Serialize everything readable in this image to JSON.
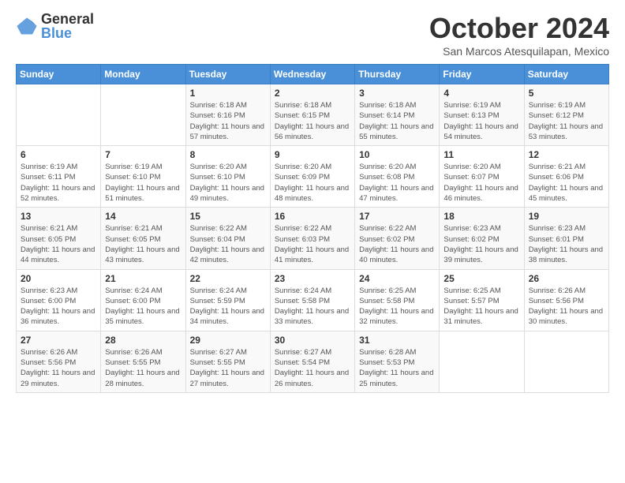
{
  "logo": {
    "general": "General",
    "blue": "Blue"
  },
  "title": {
    "month": "October 2024",
    "location": "San Marcos Atesquilapan, Mexico"
  },
  "days_of_week": [
    "Sunday",
    "Monday",
    "Tuesday",
    "Wednesday",
    "Thursday",
    "Friday",
    "Saturday"
  ],
  "weeks": [
    [
      {
        "day": "",
        "sunrise": "",
        "sunset": "",
        "daylight": ""
      },
      {
        "day": "",
        "sunrise": "",
        "sunset": "",
        "daylight": ""
      },
      {
        "day": "1",
        "sunrise": "Sunrise: 6:18 AM",
        "sunset": "Sunset: 6:16 PM",
        "daylight": "Daylight: 11 hours and 57 minutes."
      },
      {
        "day": "2",
        "sunrise": "Sunrise: 6:18 AM",
        "sunset": "Sunset: 6:15 PM",
        "daylight": "Daylight: 11 hours and 56 minutes."
      },
      {
        "day": "3",
        "sunrise": "Sunrise: 6:18 AM",
        "sunset": "Sunset: 6:14 PM",
        "daylight": "Daylight: 11 hours and 55 minutes."
      },
      {
        "day": "4",
        "sunrise": "Sunrise: 6:19 AM",
        "sunset": "Sunset: 6:13 PM",
        "daylight": "Daylight: 11 hours and 54 minutes."
      },
      {
        "day": "5",
        "sunrise": "Sunrise: 6:19 AM",
        "sunset": "Sunset: 6:12 PM",
        "daylight": "Daylight: 11 hours and 53 minutes."
      }
    ],
    [
      {
        "day": "6",
        "sunrise": "Sunrise: 6:19 AM",
        "sunset": "Sunset: 6:11 PM",
        "daylight": "Daylight: 11 hours and 52 minutes."
      },
      {
        "day": "7",
        "sunrise": "Sunrise: 6:19 AM",
        "sunset": "Sunset: 6:10 PM",
        "daylight": "Daylight: 11 hours and 51 minutes."
      },
      {
        "day": "8",
        "sunrise": "Sunrise: 6:20 AM",
        "sunset": "Sunset: 6:10 PM",
        "daylight": "Daylight: 11 hours and 49 minutes."
      },
      {
        "day": "9",
        "sunrise": "Sunrise: 6:20 AM",
        "sunset": "Sunset: 6:09 PM",
        "daylight": "Daylight: 11 hours and 48 minutes."
      },
      {
        "day": "10",
        "sunrise": "Sunrise: 6:20 AM",
        "sunset": "Sunset: 6:08 PM",
        "daylight": "Daylight: 11 hours and 47 minutes."
      },
      {
        "day": "11",
        "sunrise": "Sunrise: 6:20 AM",
        "sunset": "Sunset: 6:07 PM",
        "daylight": "Daylight: 11 hours and 46 minutes."
      },
      {
        "day": "12",
        "sunrise": "Sunrise: 6:21 AM",
        "sunset": "Sunset: 6:06 PM",
        "daylight": "Daylight: 11 hours and 45 minutes."
      }
    ],
    [
      {
        "day": "13",
        "sunrise": "Sunrise: 6:21 AM",
        "sunset": "Sunset: 6:05 PM",
        "daylight": "Daylight: 11 hours and 44 minutes."
      },
      {
        "day": "14",
        "sunrise": "Sunrise: 6:21 AM",
        "sunset": "Sunset: 6:05 PM",
        "daylight": "Daylight: 11 hours and 43 minutes."
      },
      {
        "day": "15",
        "sunrise": "Sunrise: 6:22 AM",
        "sunset": "Sunset: 6:04 PM",
        "daylight": "Daylight: 11 hours and 42 minutes."
      },
      {
        "day": "16",
        "sunrise": "Sunrise: 6:22 AM",
        "sunset": "Sunset: 6:03 PM",
        "daylight": "Daylight: 11 hours and 41 minutes."
      },
      {
        "day": "17",
        "sunrise": "Sunrise: 6:22 AM",
        "sunset": "Sunset: 6:02 PM",
        "daylight": "Daylight: 11 hours and 40 minutes."
      },
      {
        "day": "18",
        "sunrise": "Sunrise: 6:23 AM",
        "sunset": "Sunset: 6:02 PM",
        "daylight": "Daylight: 11 hours and 39 minutes."
      },
      {
        "day": "19",
        "sunrise": "Sunrise: 6:23 AM",
        "sunset": "Sunset: 6:01 PM",
        "daylight": "Daylight: 11 hours and 38 minutes."
      }
    ],
    [
      {
        "day": "20",
        "sunrise": "Sunrise: 6:23 AM",
        "sunset": "Sunset: 6:00 PM",
        "daylight": "Daylight: 11 hours and 36 minutes."
      },
      {
        "day": "21",
        "sunrise": "Sunrise: 6:24 AM",
        "sunset": "Sunset: 6:00 PM",
        "daylight": "Daylight: 11 hours and 35 minutes."
      },
      {
        "day": "22",
        "sunrise": "Sunrise: 6:24 AM",
        "sunset": "Sunset: 5:59 PM",
        "daylight": "Daylight: 11 hours and 34 minutes."
      },
      {
        "day": "23",
        "sunrise": "Sunrise: 6:24 AM",
        "sunset": "Sunset: 5:58 PM",
        "daylight": "Daylight: 11 hours and 33 minutes."
      },
      {
        "day": "24",
        "sunrise": "Sunrise: 6:25 AM",
        "sunset": "Sunset: 5:58 PM",
        "daylight": "Daylight: 11 hours and 32 minutes."
      },
      {
        "day": "25",
        "sunrise": "Sunrise: 6:25 AM",
        "sunset": "Sunset: 5:57 PM",
        "daylight": "Daylight: 11 hours and 31 minutes."
      },
      {
        "day": "26",
        "sunrise": "Sunrise: 6:26 AM",
        "sunset": "Sunset: 5:56 PM",
        "daylight": "Daylight: 11 hours and 30 minutes."
      }
    ],
    [
      {
        "day": "27",
        "sunrise": "Sunrise: 6:26 AM",
        "sunset": "Sunset: 5:56 PM",
        "daylight": "Daylight: 11 hours and 29 minutes."
      },
      {
        "day": "28",
        "sunrise": "Sunrise: 6:26 AM",
        "sunset": "Sunset: 5:55 PM",
        "daylight": "Daylight: 11 hours and 28 minutes."
      },
      {
        "day": "29",
        "sunrise": "Sunrise: 6:27 AM",
        "sunset": "Sunset: 5:55 PM",
        "daylight": "Daylight: 11 hours and 27 minutes."
      },
      {
        "day": "30",
        "sunrise": "Sunrise: 6:27 AM",
        "sunset": "Sunset: 5:54 PM",
        "daylight": "Daylight: 11 hours and 26 minutes."
      },
      {
        "day": "31",
        "sunrise": "Sunrise: 6:28 AM",
        "sunset": "Sunset: 5:53 PM",
        "daylight": "Daylight: 11 hours and 25 minutes."
      },
      {
        "day": "",
        "sunrise": "",
        "sunset": "",
        "daylight": ""
      },
      {
        "day": "",
        "sunrise": "",
        "sunset": "",
        "daylight": ""
      }
    ]
  ]
}
